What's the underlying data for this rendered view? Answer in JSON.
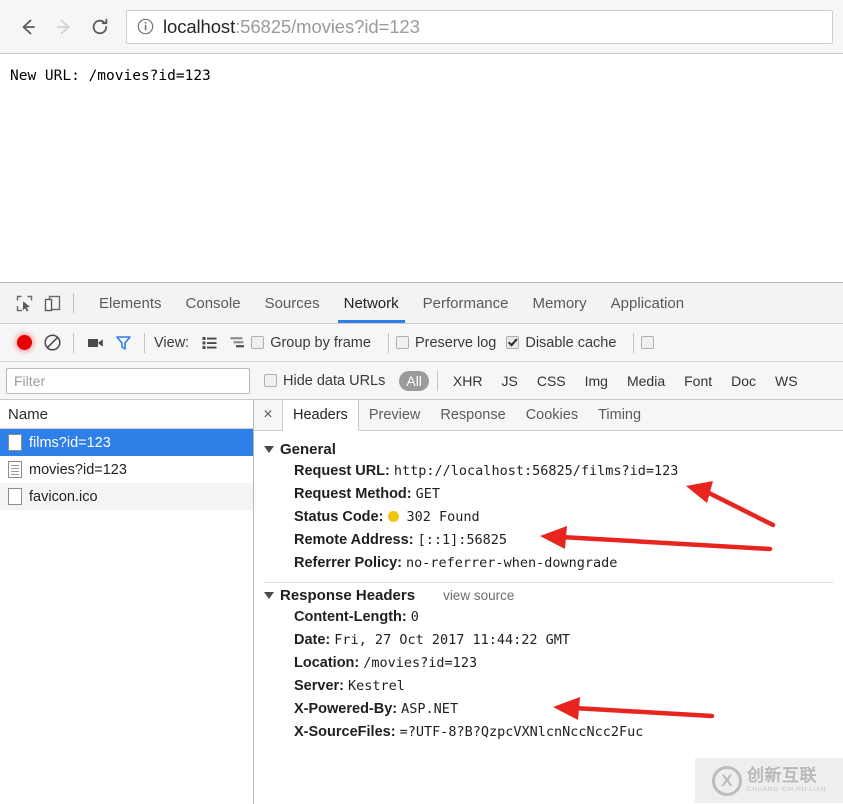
{
  "browser": {
    "back_icon": "arrow-left-icon",
    "forward_icon": "arrow-right-icon",
    "reload_icon": "reload-icon",
    "info_icon": "info-circle-icon",
    "url_host": "localhost",
    "url_rest": ":56825/movies?id=123",
    "url_full": "localhost:56825/movies?id=123"
  },
  "page": {
    "body_text": "New URL: /movies?id=123"
  },
  "devtools": {
    "inspect_icon": "inspect-element-icon",
    "device_icon": "device-toolbar-icon",
    "tabs": [
      {
        "label": "Elements",
        "active": false
      },
      {
        "label": "Console",
        "active": false
      },
      {
        "label": "Sources",
        "active": false
      },
      {
        "label": "Network",
        "active": true
      },
      {
        "label": "Performance",
        "active": false
      },
      {
        "label": "Memory",
        "active": false
      },
      {
        "label": "Application",
        "active": false
      }
    ],
    "toolbar": {
      "record_icon": "record-button-icon",
      "clear_icon": "clear-icon",
      "camera_icon": "camera-icon",
      "filter_icon": "filter-funnel-icon",
      "view_label": "View:",
      "list_view_icon": "list-view-icon",
      "waterfall_view_icon": "waterfall-view-icon",
      "group_by_frame_label": "Group by frame",
      "group_by_frame_checked": false,
      "preserve_log_label": "Preserve log",
      "preserve_log_checked": false,
      "disable_cache_label": "Disable cache",
      "disable_cache_checked": true
    },
    "filterbar": {
      "filter_placeholder": "Filter",
      "filter_value": "",
      "hide_data_urls_label": "Hide data URLs",
      "hide_data_urls_checked": false,
      "types": [
        {
          "label": "All",
          "selected": true
        },
        {
          "label": "XHR",
          "selected": false
        },
        {
          "label": "JS",
          "selected": false
        },
        {
          "label": "CSS",
          "selected": false
        },
        {
          "label": "Img",
          "selected": false
        },
        {
          "label": "Media",
          "selected": false
        },
        {
          "label": "Font",
          "selected": false
        },
        {
          "label": "Doc",
          "selected": false
        },
        {
          "label": "WS",
          "selected": false
        }
      ]
    },
    "requests": {
      "column_header": "Name",
      "rows": [
        {
          "name": "films?id=123",
          "icon": "blank-document-icon",
          "selected": true
        },
        {
          "name": "movies?id=123",
          "icon": "lined-document-icon",
          "selected": false
        },
        {
          "name": "favicon.ico",
          "icon": "blank-document-icon",
          "selected": false
        }
      ]
    },
    "detail": {
      "close_label": "×",
      "tabs": [
        {
          "label": "Headers",
          "active": true
        },
        {
          "label": "Preview",
          "active": false
        },
        {
          "label": "Response",
          "active": false
        },
        {
          "label": "Cookies",
          "active": false
        },
        {
          "label": "Timing",
          "active": false
        }
      ],
      "general": {
        "title": "General",
        "items": [
          {
            "key": "Request URL:",
            "value": "http://localhost:56825/films?id=123"
          },
          {
            "key": "Request Method:",
            "value": "GET"
          },
          {
            "key": "Status Code:",
            "value": "302 Found",
            "dot": "#f1c40f"
          },
          {
            "key": "Remote Address:",
            "value": "[::1]:56825"
          },
          {
            "key": "Referrer Policy:",
            "value": "no-referrer-when-downgrade"
          }
        ]
      },
      "response_headers": {
        "title": "Response Headers",
        "view_source_label": "view source",
        "items": [
          {
            "key": "Content-Length:",
            "value": "0"
          },
          {
            "key": "Date:",
            "value": "Fri, 27 Oct 2017 11:44:22 GMT"
          },
          {
            "key": "Location:",
            "value": "/movies?id=123"
          },
          {
            "key": "Server:",
            "value": "Kestrel"
          },
          {
            "key": "X-Powered-By:",
            "value": "ASP.NET"
          },
          {
            "key": "X-SourceFiles:",
            "value": "=?UTF-8?B?QzpcVXNlcnNccNcc2Fuc"
          }
        ]
      }
    }
  },
  "annotations": {
    "arrow_color": "#e8241f",
    "arrows": [
      {
        "name": "arrow-to-request-url"
      },
      {
        "name": "arrow-to-status-code"
      },
      {
        "name": "arrow-to-location-header"
      }
    ]
  },
  "watermark": {
    "badge": "X",
    "cn_text": "创新互联",
    "en_text": "CHUANG XIN HU LIAN"
  }
}
